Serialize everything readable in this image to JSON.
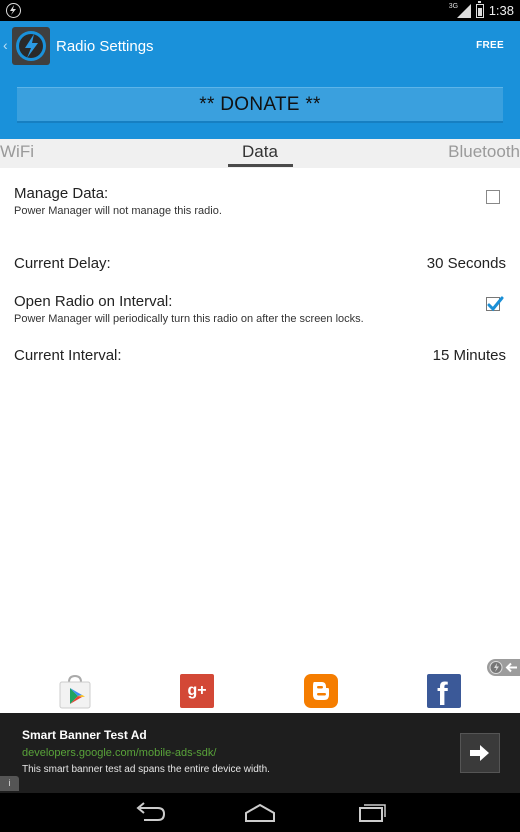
{
  "status_bar": {
    "network_label": "3G",
    "time": "1:38"
  },
  "action_bar": {
    "title": "Radio Settings",
    "free_label": "FREE",
    "donate_label": "** DONATE **"
  },
  "tabs": [
    {
      "label": "WiFi",
      "selected": false
    },
    {
      "label": "Data",
      "selected": true
    },
    {
      "label": "Bluetooth",
      "selected": false
    }
  ],
  "settings": {
    "manage_data": {
      "title": "Manage Data:",
      "summary": "Power Manager will not manage this radio.",
      "checked": false
    },
    "current_delay": {
      "title": "Current Delay:",
      "value": "30 Seconds"
    },
    "open_radio": {
      "title": "Open Radio on Interval:",
      "summary": "Power Manager will periodically turn this radio on after the screen locks.",
      "checked": true
    },
    "current_interval": {
      "title": "Current Interval:",
      "value": "15 Minutes"
    }
  },
  "social": {
    "gplus_label": "g+",
    "facebook_label": "f"
  },
  "ad": {
    "title": "Smart Banner Test Ad",
    "url": "developers.google.com/mobile-ads-sdk/",
    "description": "This smart banner test ad spans the entire device width.",
    "info_label": "i"
  },
  "colors": {
    "action_bar": "#1a91da",
    "donate_button": "#3aa0de",
    "checkbox_checked": "#1a8fd6",
    "ad_url": "#59a33a"
  }
}
